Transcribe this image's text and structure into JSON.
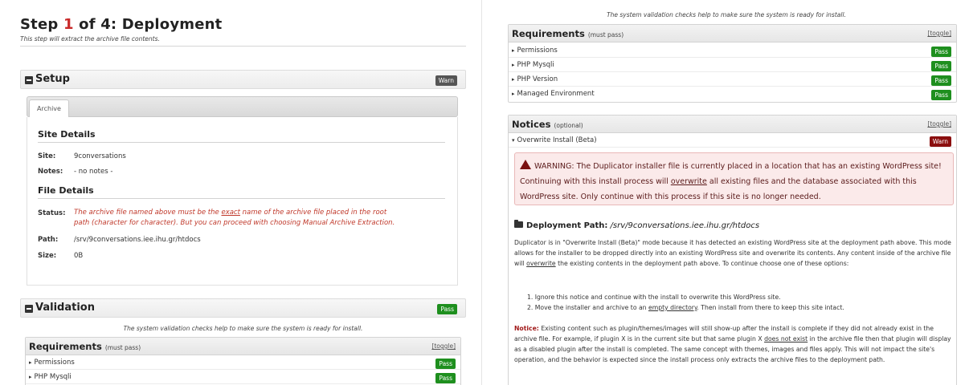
{
  "left": {
    "step": {
      "prefix": "Step",
      "num": "1",
      "suffix": "of 4: Deployment",
      "subtitle": "This step will extract the archive file contents."
    },
    "setup": {
      "title": "Setup",
      "badge": "Warn",
      "tab": "Archive",
      "site_details": {
        "heading": "Site Details",
        "site_label": "Site:",
        "site_value": "9conversations",
        "notes_label": "Notes:",
        "notes_value": "- no notes -"
      },
      "file_details": {
        "heading": "File Details",
        "status_label": "Status:",
        "status_text_1": "The archive file named above must be the ",
        "status_exact": "exact",
        "status_text_2": " name of the archive file placed in the root path (character for character). But you can proceed with choosing Manual Archive Extraction.",
        "path_label": "Path:",
        "path_value": "/srv/9conversations.iee.ihu.gr/htdocs",
        "size_label": "Size:",
        "size_value": "0B"
      }
    },
    "validation": {
      "title": "Validation",
      "badge": "Pass",
      "intro": "The system validation checks help to make sure the system is ready for install.",
      "requirements": {
        "title": "Requirements",
        "qualifier": "(must pass)",
        "toggle": "[toggle]",
        "items": [
          {
            "name": "Permissions",
            "badge": "Pass"
          },
          {
            "name": "PHP Mysqli",
            "badge": "Pass"
          }
        ]
      }
    }
  },
  "right": {
    "intro": "The system validation checks help to make sure the system is ready for install.",
    "requirements": {
      "title": "Requirements",
      "qualifier": "(must pass)",
      "toggle": "[toggle]",
      "items": [
        {
          "name": "Permissions",
          "badge": "Pass"
        },
        {
          "name": "PHP Mysqli",
          "badge": "Pass"
        },
        {
          "name": "PHP Version",
          "badge": "Pass"
        },
        {
          "name": "Managed Environment",
          "badge": "Pass"
        }
      ]
    },
    "notices": {
      "title": "Notices",
      "qualifier": "(optional)",
      "toggle": "[toggle]",
      "item": {
        "name": "Overwrite Install (Beta)",
        "badge": "Warn"
      },
      "warning": {
        "part1": "WARNING: The Duplicator installer file is currently placed in a location that has an existing WordPress site! Continuing with this install process will ",
        "overwrite": "overwrite",
        "part2": " all existing files and the database associated with this WordPress site. Only continue with this process if this site is no longer needed."
      },
      "deployment_path": {
        "label": "Deployment Path:",
        "value": "/srv/9conversations.iee.ihu.gr/htdocs"
      },
      "para1": {
        "a": "Duplicator is in \"Overwrite Install (Beta)\" mode because it has detected an existing WordPress site at the deployment path above. This mode allows for the installer to be dropped directly into an existing WordPress site and overwrite its contents. Any content inside of the archive file will ",
        "overwrite": "overwrite",
        "b": " the existing contents in the deployment path above. To continue choose one of these options:"
      },
      "options": {
        "one": "1. Ignore this notice and continue with the install to overwrite this WordPress site.",
        "two_a": "2. Move the installer and archive to an ",
        "two_link": "empty directory",
        "two_b": ". Then install from there to keep this site intact."
      },
      "notice": {
        "label": "Notice:",
        "a": " Existing content such as plugin/themes/images will still show-up after the install is complete if they did not already exist in the archive file. For example, if plugin X is in the current site but that same plugin X ",
        "not_exist": "does not exist",
        "b": " in the archive file then that plugin will display as a disabled plugin after the install is completed. The same concept with themes, images and files apply. This will not impact the site's operation, and the behavior is expected since the install process only extracts the archive files to the deployment path."
      }
    }
  },
  "colors": {
    "pass": "#1e8f1e",
    "warn_red": "#8b0f0f",
    "warn_grey": "#555555",
    "step_num": "#c92a2a"
  }
}
